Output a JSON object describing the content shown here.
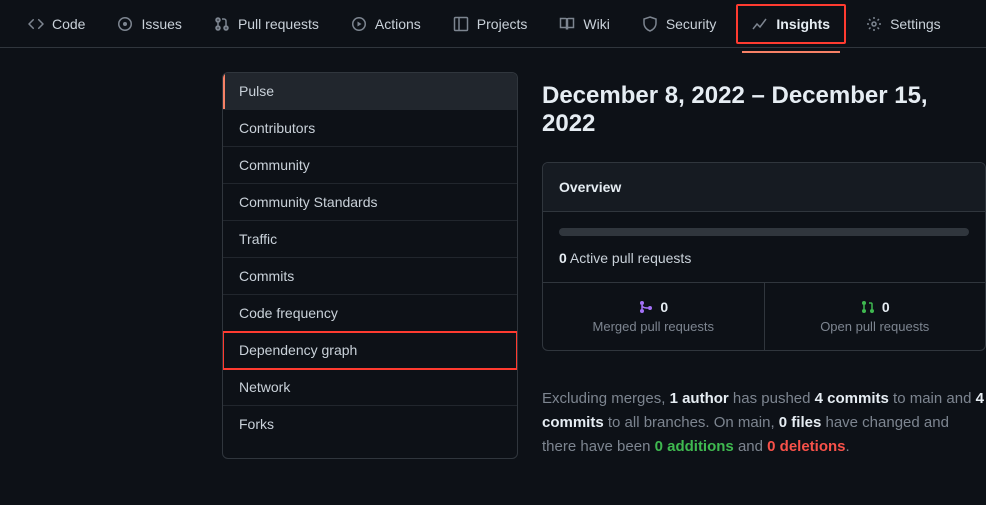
{
  "nav": {
    "code": "Code",
    "issues": "Issues",
    "pull_requests": "Pull requests",
    "actions": "Actions",
    "projects": "Projects",
    "wiki": "Wiki",
    "security": "Security",
    "insights": "Insights",
    "settings": "Settings"
  },
  "sidebar": {
    "items": [
      "Pulse",
      "Contributors",
      "Community",
      "Community Standards",
      "Traffic",
      "Commits",
      "Code frequency",
      "Dependency graph",
      "Network",
      "Forks"
    ]
  },
  "date_range": "December 8, 2022 – December 15, 2022",
  "overview": {
    "title": "Overview",
    "active_pr_count": "0",
    "active_pr_label": "Active pull requests",
    "merged": {
      "count": "0",
      "label": "Merged pull requests"
    },
    "open": {
      "count": "0",
      "label": "Open pull requests"
    }
  },
  "summary": {
    "pre": "Excluding merges, ",
    "authors": "1 author",
    "mid1": " has pushed ",
    "commits_main": "4 commits",
    "mid2": " to main and ",
    "commits_all": "4 commits",
    "mid3": " to all branches. On main, ",
    "files": "0 files",
    "mid4": " have changed and there have been ",
    "additions": "0 additions",
    "and": " and ",
    "deletions": "0 deletions",
    "end": "."
  }
}
